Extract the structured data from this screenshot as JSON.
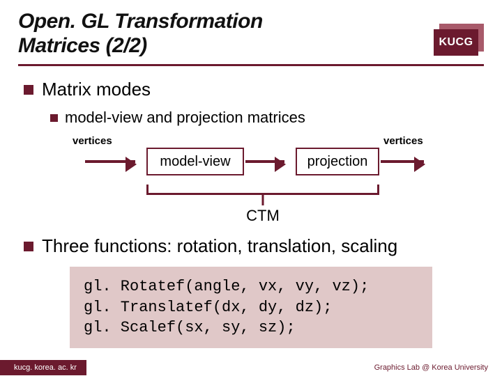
{
  "title_line1": "Open. GL Transformation",
  "title_line2": "Matrices (2/2)",
  "logo": "KUCG",
  "bullets": {
    "matrix_modes": "Matrix modes",
    "sub_modelview": "model-view and projection matrices",
    "three_functions": "Three functions: rotation, translation, scaling"
  },
  "diagram": {
    "vertices_left": "vertices",
    "vertices_right": "vertices",
    "box_modelview": "model-view",
    "box_projection": "projection",
    "ctm": "CTM"
  },
  "code": {
    "l1": "gl. Rotatef(angle, vx, vy, vz);",
    "l2": "gl. Translatef(dx, dy, dz);",
    "l3": "gl. Scalef(sx, sy, sz);"
  },
  "footer": {
    "left": "kucg. korea. ac. kr",
    "right": "Graphics Lab @ Korea University"
  }
}
